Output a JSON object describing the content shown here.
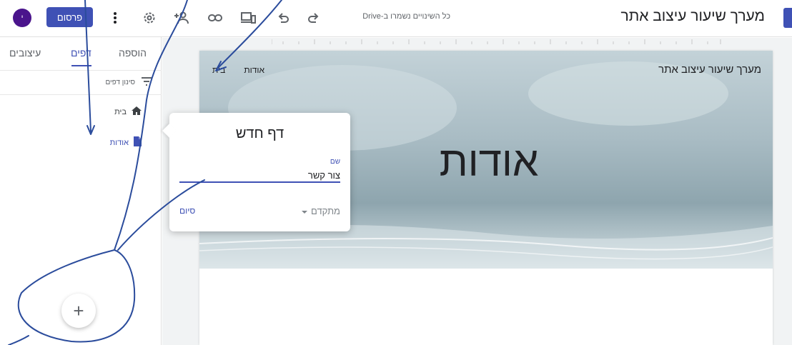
{
  "topbar": {
    "avatar_initial": "י",
    "publish_label": "פרסום",
    "saved_status": "כל השינויים נשמרו ב-Drive",
    "site_title": "מערך שיעור עיצוב אתר",
    "icons": [
      "more-vert-icon",
      "settings-icon",
      "share-person-icon",
      "link-icon",
      "preview-devices-icon",
      "undo-icon",
      "redo-icon"
    ]
  },
  "side_panel": {
    "tabs": [
      {
        "label": "הוספה",
        "active": false
      },
      {
        "label": "דפים",
        "active": true
      },
      {
        "label": "עיצובים",
        "active": false
      }
    ],
    "filter_label": "סינון דפים",
    "pages": [
      {
        "label": "בית",
        "icon": "home-icon",
        "active": false
      },
      {
        "label": "אודות",
        "icon": "page-icon",
        "active": true
      }
    ],
    "fab_label": "+"
  },
  "canvas": {
    "site_name": "מערך שיעור עיצוב אתר",
    "nav": [
      "בית",
      "אודות"
    ],
    "hero_title": "אודות"
  },
  "dialog": {
    "title": "דף חדש",
    "name_label": "שם",
    "name_value": "צור קשר",
    "advanced_label": "מתקדם",
    "done_label": "סיום"
  },
  "colors": {
    "accent": "#3f51b5",
    "avatar": "#4a148c",
    "annotation": "#2b4c9c"
  }
}
